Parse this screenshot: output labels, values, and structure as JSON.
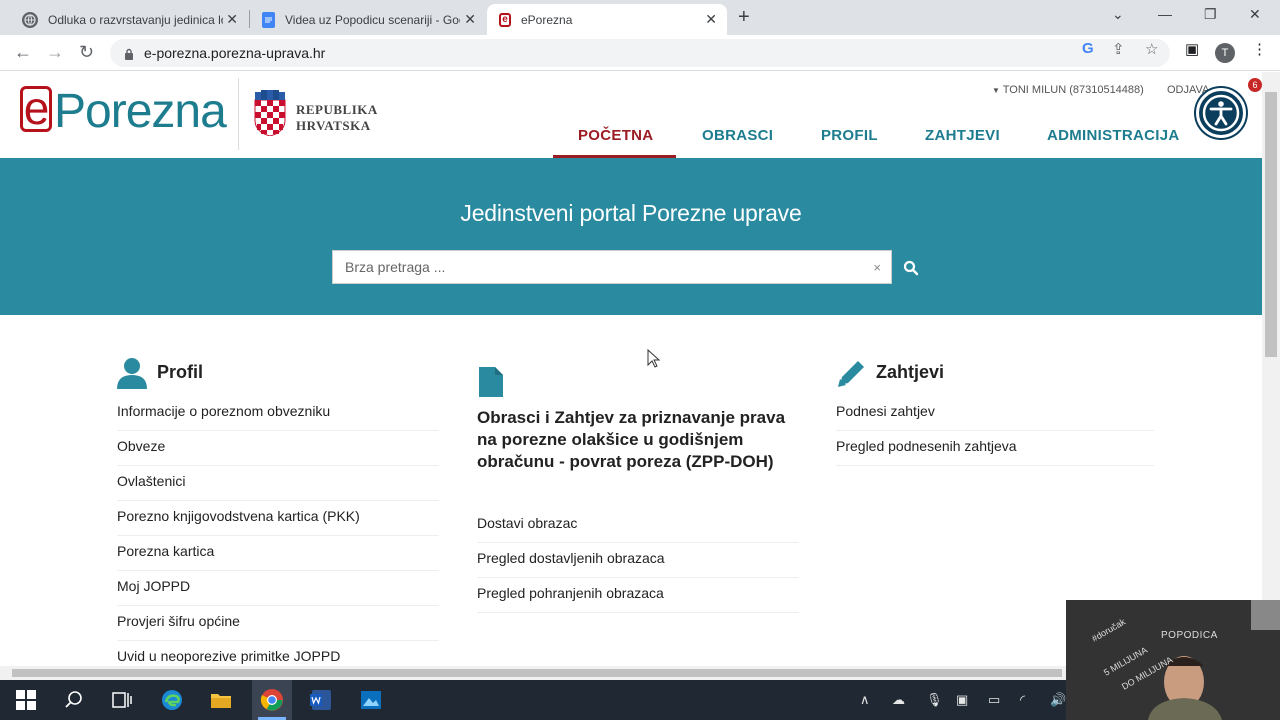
{
  "browser": {
    "tabs": [
      {
        "title": "Odluka o razvrstavanju jedinica lo",
        "active": false,
        "favicon": "globe-icon"
      },
      {
        "title": "Videa uz Popodicu scenariji - Goo",
        "active": false,
        "favicon": "docs-icon"
      },
      {
        "title": "ePorezna",
        "active": true,
        "favicon": "eporezna-icon"
      }
    ],
    "url": "e-porezna.porezna-uprava.hr",
    "profile_initial": "T"
  },
  "header": {
    "logo_e": "e",
    "logo_rest": "Porezna",
    "republika": "REPUBLIKA",
    "hrvatska": "HRVATSKA",
    "user": "TONI MILUN (87310514488)",
    "logout": "ODJAVA",
    "notifications": "6",
    "menu": [
      "POČETNA",
      "OBRASCI",
      "PROFIL",
      "ZAHTJEVI",
      "ADMINISTRACIJA"
    ]
  },
  "hero": {
    "title": "Jedinstveni portal Porezne uprave",
    "search_placeholder": "Brza pretraga ...",
    "clear": "×"
  },
  "profil": {
    "title": "Profil",
    "links": [
      "Informacije o poreznom obvezniku",
      "Obveze",
      "Ovlaštenici",
      "Porezno knjigovodstvena kartica (PKK)",
      "Porezna kartica",
      "Moj JOPPD",
      "Provjeri šifru općine",
      "Uvid u neoporezive primitke JOPPD"
    ]
  },
  "obrasci": {
    "title": "Obrasci i Zahtjev za priznavanje prava na porezne olakšice u godišnjem obračunu - povrat poreza (ZPP-DOH)",
    "links": [
      "Dostavi obrazac",
      "Pregled dostavljenih obrazaca",
      "Pregled pohranjenih obrazaca"
    ]
  },
  "zahtjevi": {
    "title": "Zahtjevi",
    "links": [
      "Podnesi zahtjev",
      "Pregled podnesenih zahtjeva"
    ]
  },
  "webcam": {
    "label": "POPODICA",
    "board_text": "#doručak 5 MILIJUNA DO MILIJUNA"
  },
  "colors": {
    "brand_teal": "#2a8ba0",
    "brand_red": "#9b1c23",
    "menu_teal": "#1d7d8f"
  }
}
